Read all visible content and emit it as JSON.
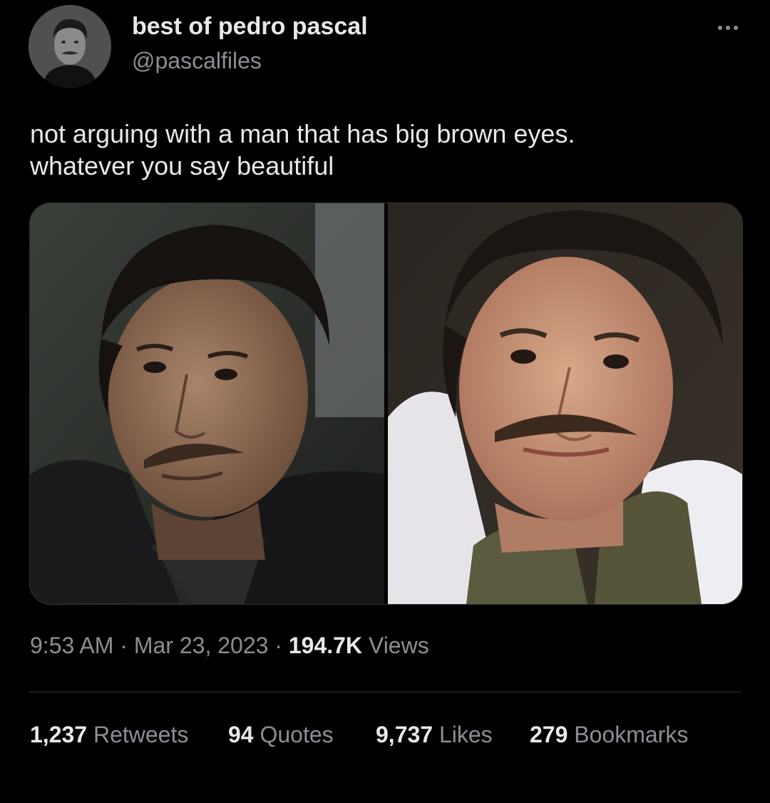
{
  "author": {
    "display_name": "best of pedro pascal",
    "handle": "@pascalfiles",
    "avatar_icon": "profile-photo"
  },
  "more_icon": "more-options-icon",
  "tweet": {
    "text_line_1": "not arguing with a man that has big brown eyes.",
    "text_line_2": "whatever you say beautiful"
  },
  "media": {
    "left_photo": "man-with-mustache-dark-jacket",
    "right_photo": "man-with-mustache-white-collar"
  },
  "meta": {
    "time": "9:53 AM",
    "separator": "·",
    "date": "Mar 23, 2023",
    "views_count": "194.7K",
    "views_label": "Views"
  },
  "stats": {
    "retweets_count": "1,237",
    "retweets_label": "Retweets",
    "quotes_count": "94",
    "quotes_label": "Quotes",
    "likes_count": "9,737",
    "likes_label": "Likes",
    "bookmarks_count": "279",
    "bookmarks_label": "Bookmarks"
  },
  "colors": {
    "background": "#000000",
    "primary_text": "#e7e9ea",
    "secondary_text": "#8b8f94",
    "divider": "#2f3336"
  }
}
